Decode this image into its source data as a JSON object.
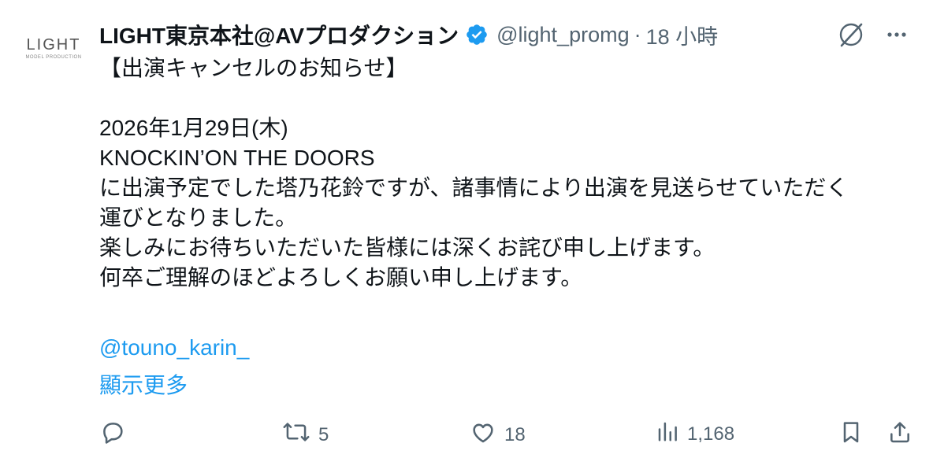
{
  "author": {
    "avatar_logo": "LIGHT",
    "avatar_sub": "MODEL PRODUCTION",
    "name": "LIGHT東京本社@AVプロダクション",
    "handle": "@light_promg",
    "separator": "·",
    "time": "18 小時",
    "verified_color": "#1d9bf0"
  },
  "icons": {
    "grok": "grok-icon",
    "more": "more-icon",
    "reply": "reply-icon",
    "retweet": "retweet-icon",
    "like": "like-icon",
    "views": "views-icon",
    "bookmark": "bookmark-icon",
    "share": "share-icon"
  },
  "tweet": {
    "text": "【出演キャンセルのお知らせ】\n\n2026年1月29日(木)\nKNOCKIN’ON THE DOORS\nに出演予定でした塔乃花鈴ですが、諸事情により出演を見送らせていただく\n運びとなりました。\n楽しみにお待ちいただいた皆様には深くお詫び申し上げます。\n何卒ご理解のほどよろしくお願い申し上げます。",
    "mention": "@touno_karin_",
    "show_more": "顯示更多"
  },
  "metrics": {
    "retweets": "5",
    "likes": "18",
    "views": "1,168"
  },
  "colors": {
    "link": "#1d9bf0",
    "muted": "#536471",
    "text": "#0f1419"
  }
}
